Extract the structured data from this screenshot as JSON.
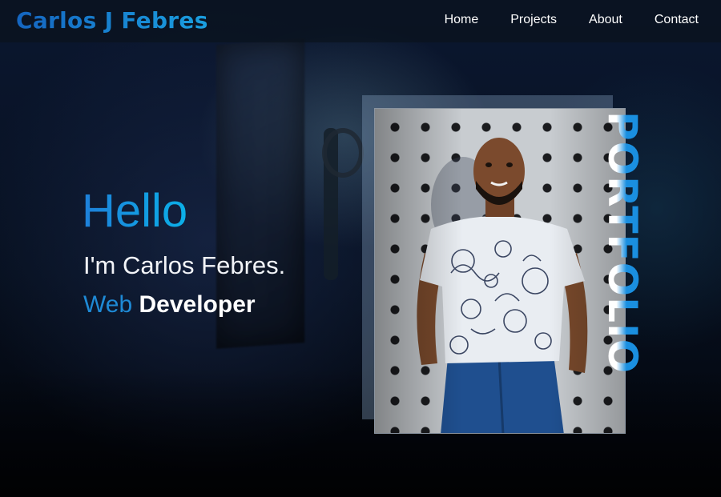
{
  "header": {
    "brand": "Carlos J Febres",
    "nav": [
      "Home",
      "Projects",
      "About",
      "Contact"
    ]
  },
  "hero": {
    "greeting": "Hello",
    "intro": "I'm Carlos Febres.",
    "role_prefix": "Web",
    "role": "Developer",
    "side_word": "PORTFOLIO"
  },
  "colors": {
    "accent": "#1e8ad6",
    "accent_light": "#0bb0e8",
    "background": "#050a16"
  }
}
